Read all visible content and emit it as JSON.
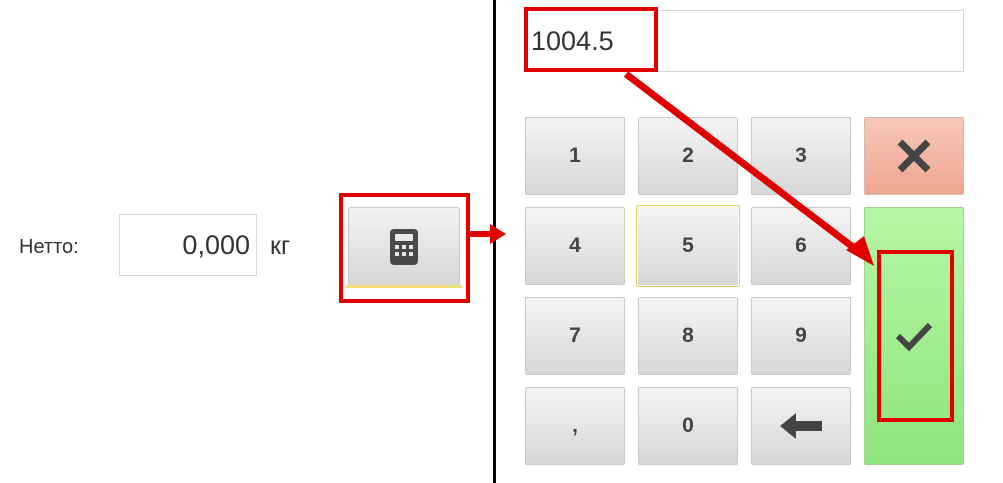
{
  "left_panel": {
    "netto_label": "Нетто:",
    "netto_value": "0,000",
    "netto_unit": "кг",
    "calculator_button_icon": "calculator-icon"
  },
  "keypad": {
    "display_value": "1004.5",
    "keys": [
      "1",
      "2",
      "3",
      "4",
      "5",
      "6",
      "7",
      "8",
      "9",
      ",",
      "0"
    ],
    "backspace_icon": "arrow-left-icon",
    "cancel_icon": "close-icon",
    "confirm_icon": "checkmark-icon"
  },
  "colors": {
    "annotation_red": "#e00000",
    "cancel_key": "#f1b3a1",
    "confirm_key": "#a2ee90",
    "focus_border": "#e5cf62"
  }
}
